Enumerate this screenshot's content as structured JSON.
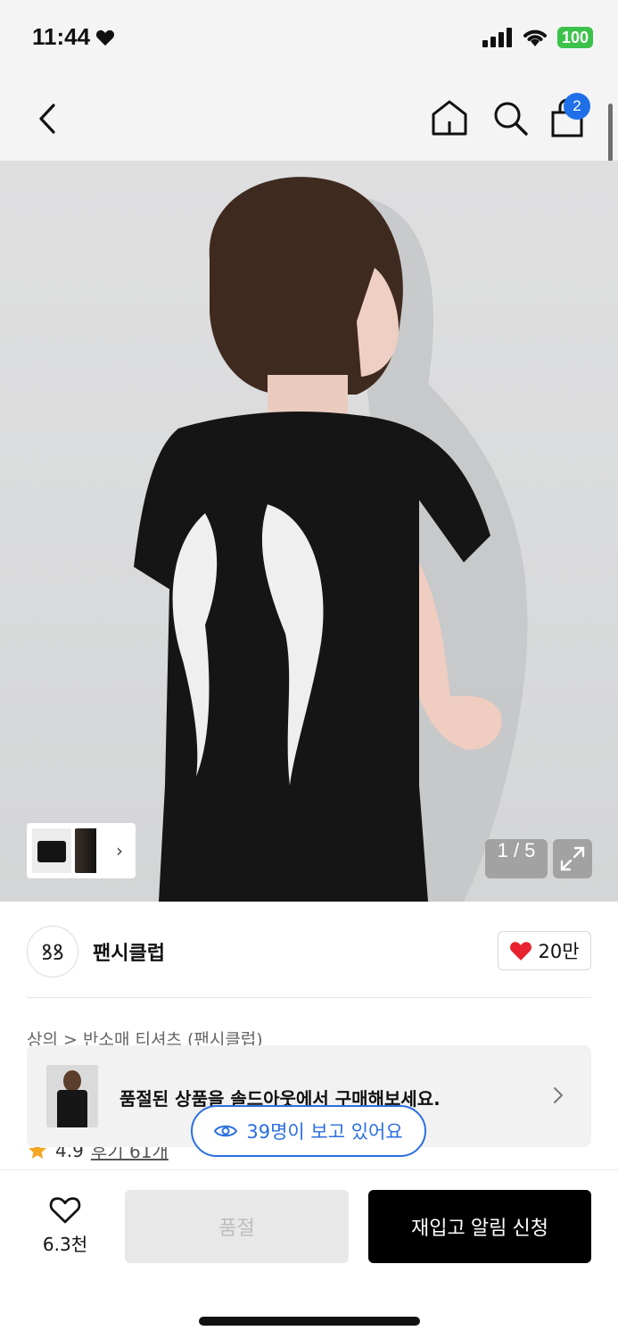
{
  "status_bar": {
    "time": "11:44",
    "battery": "100"
  },
  "nav": {
    "cart_count": "2"
  },
  "gallery": {
    "counter": "1 / 5",
    "thumb_more": "›"
  },
  "brand": {
    "name": "팬시클럽",
    "logo_text": "ꝸꝸ",
    "likes": "20만"
  },
  "breadcrumb": {
    "level1": "상의",
    "sep": ">",
    "level2": "반소매 티셔츠 (팬시클럽)"
  },
  "rating": {
    "score": "4.9",
    "reviews": "후기 61개"
  },
  "soldout_banner": {
    "text": "품절된 상품을 솔드아웃에서 구매해보세요."
  },
  "viewers": {
    "text": "39명이 보고 있어요"
  },
  "bottom": {
    "wish_count": "6.3천",
    "soldout_label": "품절",
    "restock_label": "재입고 알림 신청"
  },
  "colors": {
    "accent_blue": "#2a6fe0",
    "badge_blue": "#1e6fe8",
    "heart_red": "#e8222e",
    "battery_green": "#3cc24a",
    "star": "#f5a623"
  }
}
